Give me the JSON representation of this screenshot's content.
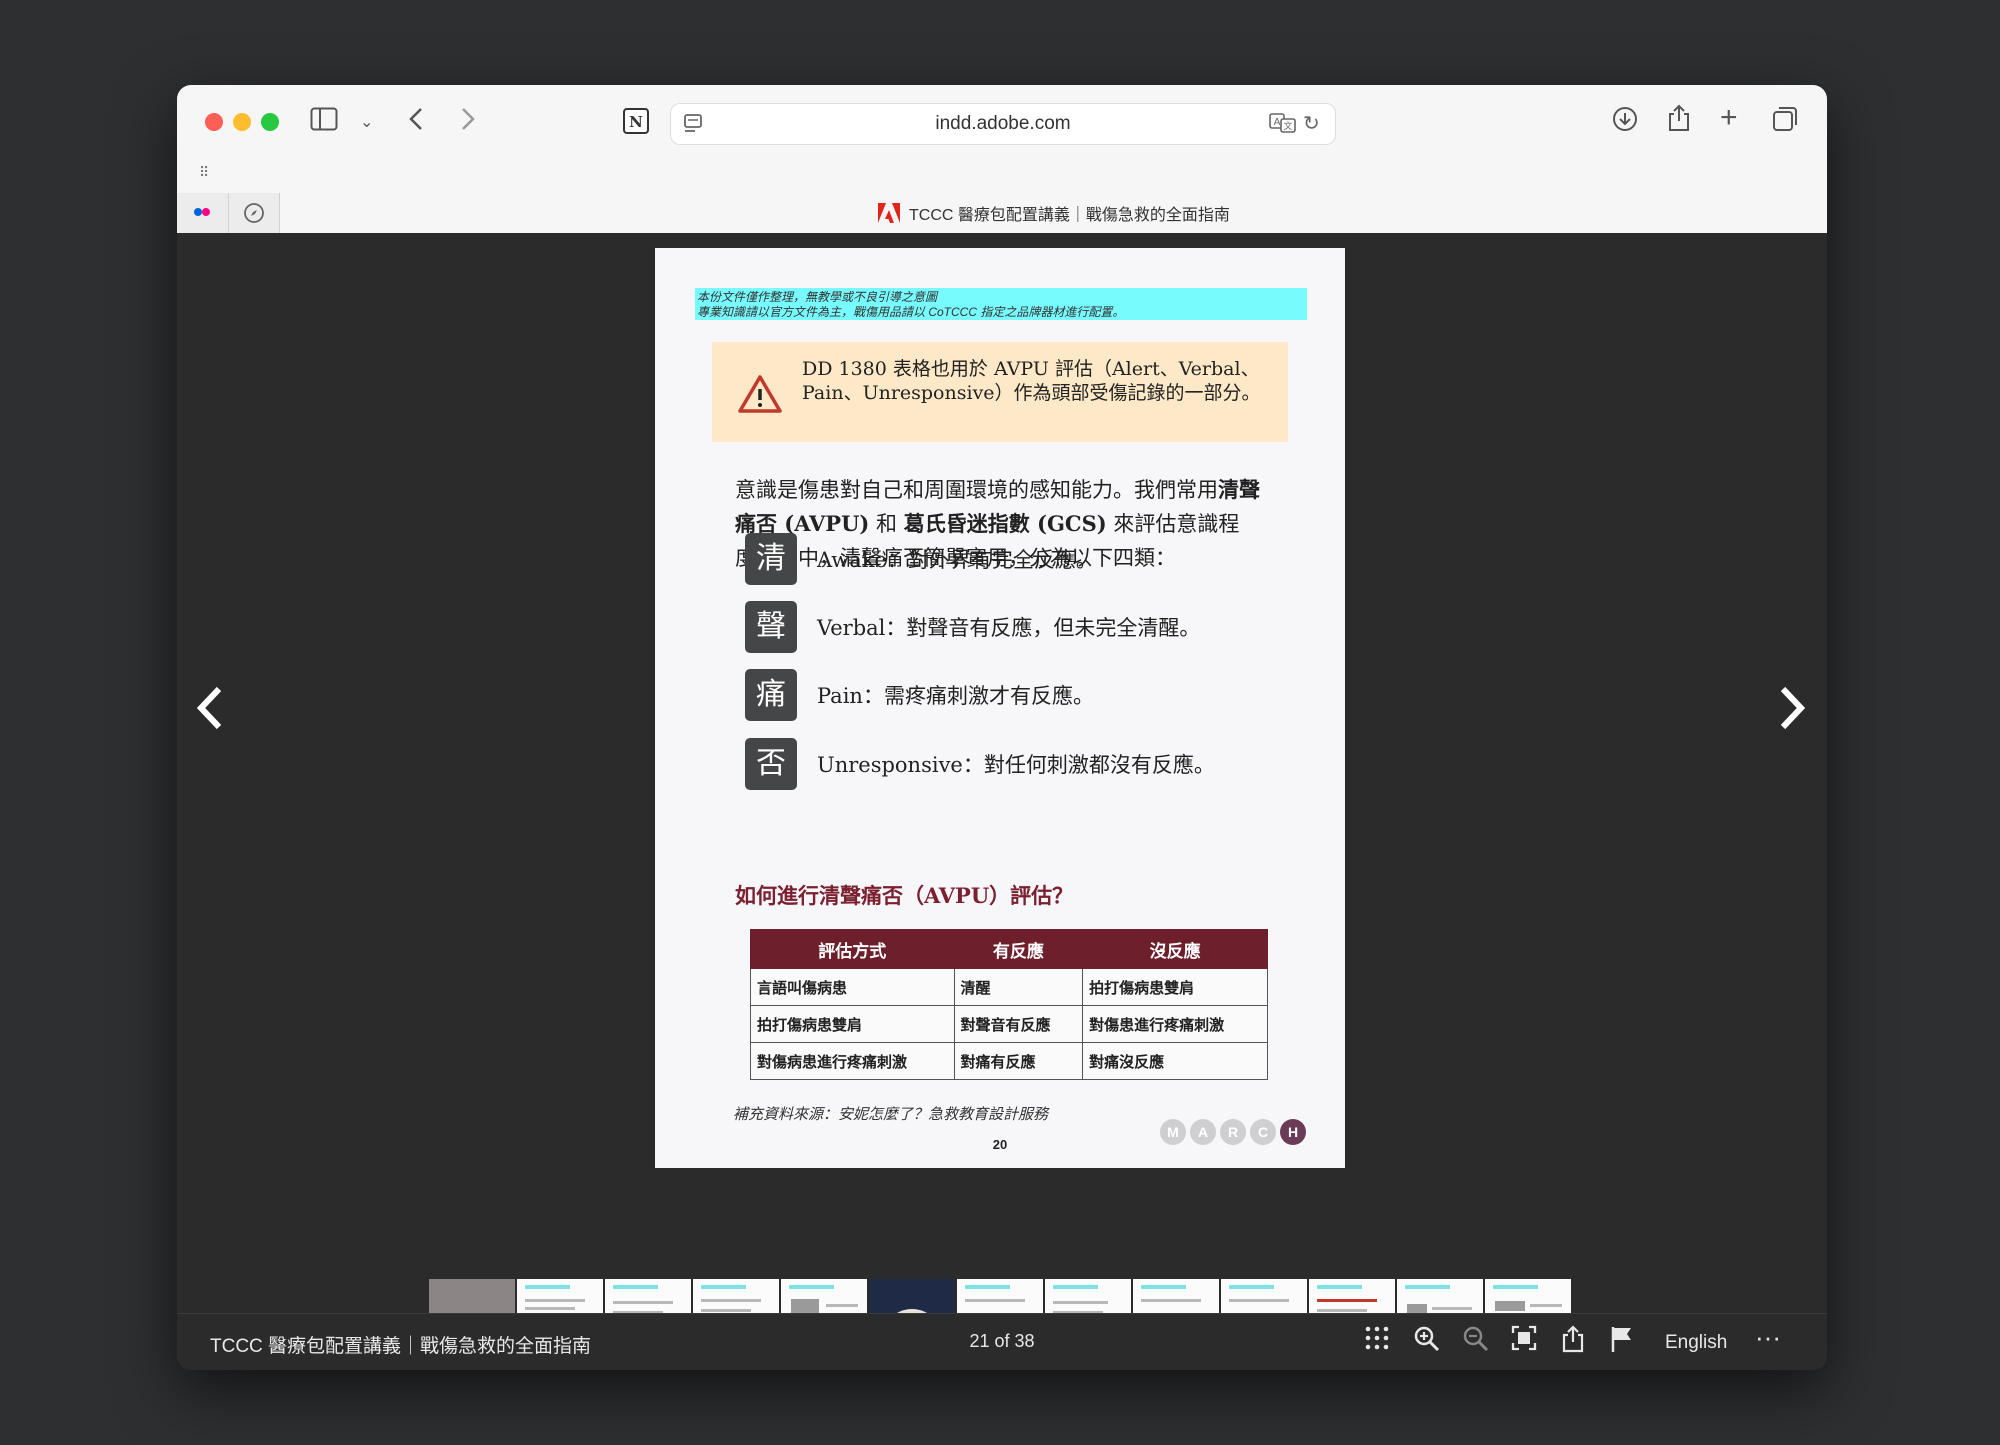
{
  "browser": {
    "url": "indd.adobe.com",
    "tab_title": "TCCC 醫療包配置講義｜戰傷急救的全面指南",
    "colors": {
      "close": "#ff5f57",
      "minimize": "#febc2e",
      "zoom": "#28c840"
    },
    "icons": [
      "sidebar-icon",
      "chevron-down-icon",
      "back-icon",
      "forward-icon",
      "notion-icon",
      "reader-icon",
      "translate-icon",
      "reload-icon",
      "download-icon",
      "share-icon",
      "new-tab-icon",
      "tabs-overview-icon",
      "grid-icon",
      "flickr-icon",
      "compass-icon"
    ]
  },
  "document": {
    "disclaimer": [
      "本份文件僅作整理，無教學或不良引導之意圖",
      "專業知識請以官方文件為主，戰傷用品請以 CoTCCC 指定之品牌器材進行配置。"
    ],
    "warning": "DD 1380 表格也用於 AVPU 評估（Alert、Verbal、Pain、Unresponsive）作為頭部受傷記錄的一部分。",
    "intro": {
      "part1": "意識是傷患對自己和周圍環境的感知能力。我們常用",
      "avpu": "清聲痛否 (AVPU)",
      "part2": " 和 ",
      "gcs": "葛氏昏迷指數 (GCS)",
      "part3": " 來評估意識程度。其中，清聲痛否簡單實用，分為以下四類："
    },
    "levels": [
      {
        "glyph": "清",
        "text": "Awake：對外界有完全反應。"
      },
      {
        "glyph": "聲",
        "text": "Verbal：對聲音有反應，但未完全清醒。"
      },
      {
        "glyph": "痛",
        "text": "Pain：需疼痛刺激才有反應。"
      },
      {
        "glyph": "否",
        "text": "Unresponsive：對任何刺激都沒有反應。"
      }
    ],
    "subhead": "如何進行清聲痛否（AVPU）評估？",
    "table": {
      "headers": [
        "評估方式",
        "有反應",
        "沒反應"
      ],
      "rows": [
        [
          "言語叫傷病患",
          "清醒",
          "拍打傷病患雙肩"
        ],
        [
          "拍打傷病患雙肩",
          "對聲音有反應",
          "對傷患進行疼痛刺激"
        ],
        [
          "對傷病患進行疼痛刺激",
          "對痛有反應",
          "對痛沒反應"
        ]
      ]
    },
    "source": "補充資料來源：安妮怎麼了？急救教育設計服務",
    "page_number": "20",
    "march": [
      "M",
      "A",
      "R",
      "C",
      "H"
    ],
    "march_active": "H"
  },
  "viewer": {
    "title": "TCCC 醫療包配置講義｜戰傷急救的全面指南",
    "page_indicator": "21 of 38",
    "language": "English",
    "thumbnail_count": 13,
    "icons": [
      "prev-page-icon",
      "next-page-icon",
      "thumbnails-next-icon",
      "grid-view-icon",
      "zoom-in-icon",
      "zoom-out-icon",
      "fullscreen-icon",
      "share-icon",
      "flag-icon",
      "more-icon"
    ]
  }
}
